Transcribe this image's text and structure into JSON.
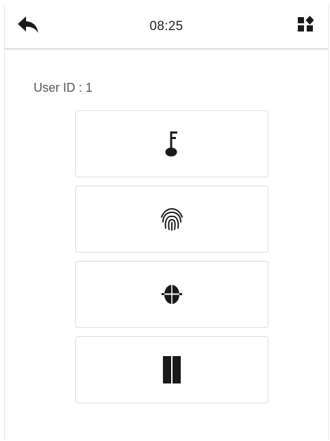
{
  "header": {
    "time": "08:25",
    "back_icon": "back-arrow-icon",
    "menu_icon": "grid-menu-icon"
  },
  "user": {
    "id_label": "User ID : 1"
  },
  "verification_methods": [
    {
      "icon": "password-key-icon"
    },
    {
      "icon": "fingerprint-icon"
    },
    {
      "icon": "face-icon"
    },
    {
      "icon": "card-icon"
    }
  ],
  "colors": {
    "icon": "#1a1a1a",
    "border": "#dcdcdc",
    "divider": "#bdbdbd",
    "text": "#555555"
  }
}
